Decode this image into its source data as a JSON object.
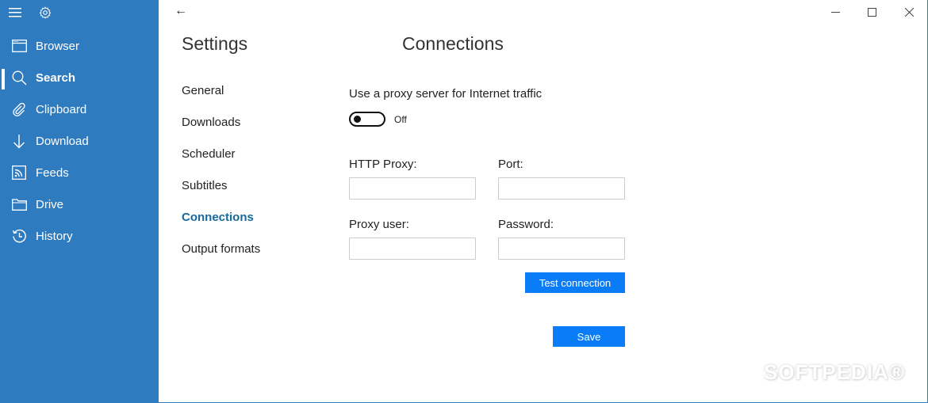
{
  "sidebar": {
    "menu_icon": "hamburger-icon",
    "settings_icon": "gear-icon",
    "items": [
      {
        "label": "Browser",
        "icon": "browser-window-icon",
        "active": false
      },
      {
        "label": "Search",
        "icon": "search-icon",
        "active": true
      },
      {
        "label": "Clipboard",
        "icon": "paperclip-icon",
        "active": false
      },
      {
        "label": "Download",
        "icon": "download-arrow-icon",
        "active": false
      },
      {
        "label": "Feeds",
        "icon": "rss-feed-icon",
        "active": false
      },
      {
        "label": "Drive",
        "icon": "folder-icon",
        "active": false
      },
      {
        "label": "History",
        "icon": "history-clock-icon",
        "active": false
      }
    ],
    "background_color": "#2f7bbf"
  },
  "titlebar": {
    "back_glyph": "←",
    "minimize_glyph": "—",
    "maximize_glyph": "☐",
    "close_glyph": "✕"
  },
  "settings": {
    "title": "Settings",
    "categories": [
      {
        "label": "General",
        "active": false
      },
      {
        "label": "Downloads",
        "active": false
      },
      {
        "label": "Scheduler",
        "active": false
      },
      {
        "label": "Subtitles",
        "active": false
      },
      {
        "label": "Connections",
        "active": true
      },
      {
        "label": "Output formats",
        "active": false
      }
    ],
    "active_color": "#17699d"
  },
  "connections": {
    "title": "Connections",
    "proxy_toggle_label": "Use a proxy server for Internet traffic",
    "proxy_toggle_state": "Off",
    "http_proxy_label": "HTTP Proxy:",
    "http_proxy_value": "",
    "port_label": "Port:",
    "port_value": "",
    "proxy_user_label": "Proxy user:",
    "proxy_user_value": "",
    "password_label": "Password:",
    "password_value": "",
    "test_button": "Test connection",
    "save_button": "Save",
    "button_color": "#0a7cf7"
  },
  "watermark": "SOFTPEDIA®"
}
